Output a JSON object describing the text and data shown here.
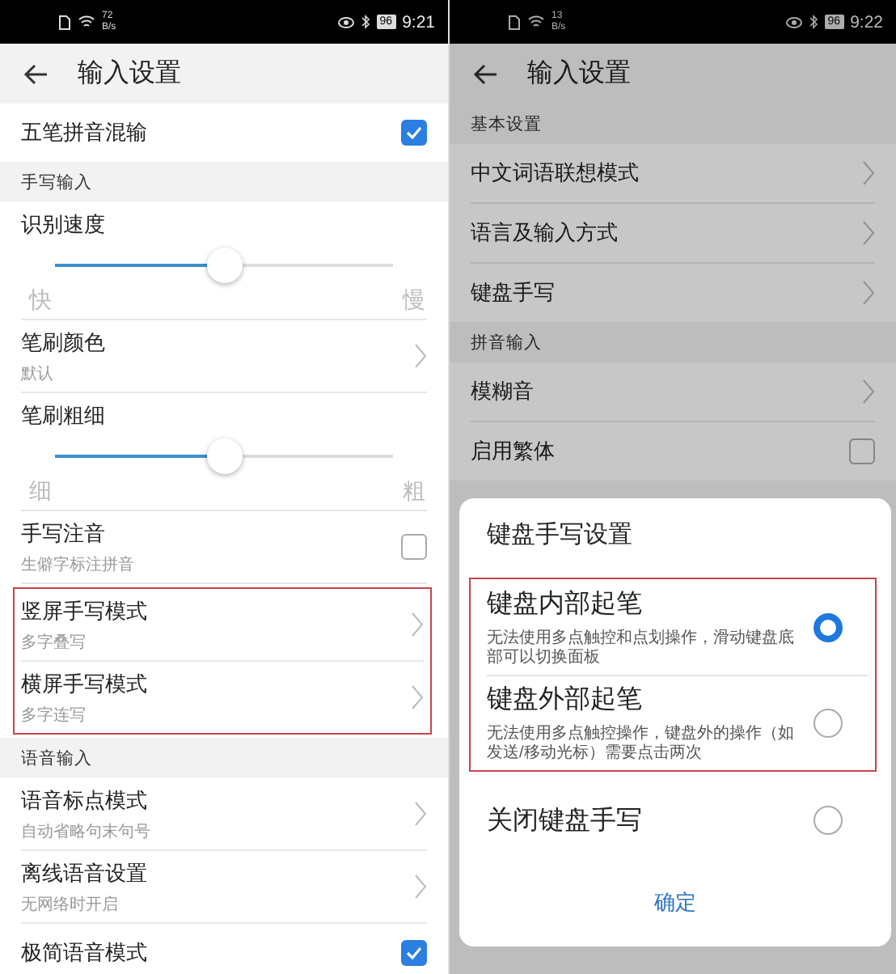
{
  "screens": [
    {
      "status_bar": {
        "speed": "72",
        "speed_unit": "B/s",
        "battery": "96",
        "time": "9:21"
      },
      "header": {
        "title": "输入设置"
      },
      "items": [
        {
          "kind": "checkbox",
          "title": "五笔拼音混输",
          "checked": true
        },
        {
          "kind": "section",
          "title": "手写输入"
        },
        {
          "kind": "slider",
          "title": "识别速度",
          "level": 0.5,
          "min_label": "快",
          "max_label": "慢"
        },
        {
          "kind": "nav",
          "title": "笔刷颜色",
          "subtitle": "默认"
        },
        {
          "kind": "slider",
          "title": "笔刷粗细",
          "level": 0.5,
          "min_label": "细",
          "max_label": "粗"
        },
        {
          "kind": "checkbox",
          "title": "手写注音",
          "subtitle": "生僻字标注拼音",
          "checked": false
        },
        {
          "kind": "group",
          "highlighted": true,
          "items": [
            {
              "kind": "nav",
              "title": "竖屏手写模式",
              "subtitle": "多字叠写"
            },
            {
              "kind": "nav",
              "title": "横屏手写模式",
              "subtitle": "多字连写"
            }
          ]
        },
        {
          "kind": "section",
          "title": "语音输入"
        },
        {
          "kind": "nav",
          "title": "语音标点模式",
          "subtitle": "自动省略句末句号"
        },
        {
          "kind": "nav",
          "title": "离线语音设置",
          "subtitle": "无网络时开启"
        },
        {
          "kind": "checkbox",
          "title": "极简语音模式",
          "checked": true
        }
      ]
    },
    {
      "status_bar": {
        "speed": "13",
        "speed_unit": "B/s",
        "battery": "96",
        "time": "9:22"
      },
      "header": {
        "title": "输入设置"
      },
      "items": [
        {
          "kind": "section",
          "title": "基本设置"
        },
        {
          "kind": "nav",
          "title": "中文词语联想模式"
        },
        {
          "kind": "nav",
          "title": "语言及输入方式"
        },
        {
          "kind": "nav",
          "title": "键盘手写"
        },
        {
          "kind": "section",
          "title": "拼音输入"
        },
        {
          "kind": "nav",
          "title": "模糊音"
        },
        {
          "kind": "checkbox",
          "title": "启用繁体",
          "checked": false
        }
      ],
      "dialog": {
        "title": "键盘手写设置",
        "option_groups": [
          {
            "highlighted": true,
            "options": [
              {
                "title": "键盘内部起笔",
                "description": "无法使用多点触控和点划操作，滑动键盘底部可以切换面板",
                "selected": true
              },
              {
                "title": "键盘外部起笔",
                "description": "无法使用多点触控操作，键盘外的操作（如发送/移动光标）需要点击两次",
                "selected": false
              }
            ]
          },
          {
            "highlighted": false,
            "options": [
              {
                "title": "关闭键盘手写",
                "selected": false
              }
            ]
          }
        ],
        "confirm": "确定"
      }
    }
  ]
}
